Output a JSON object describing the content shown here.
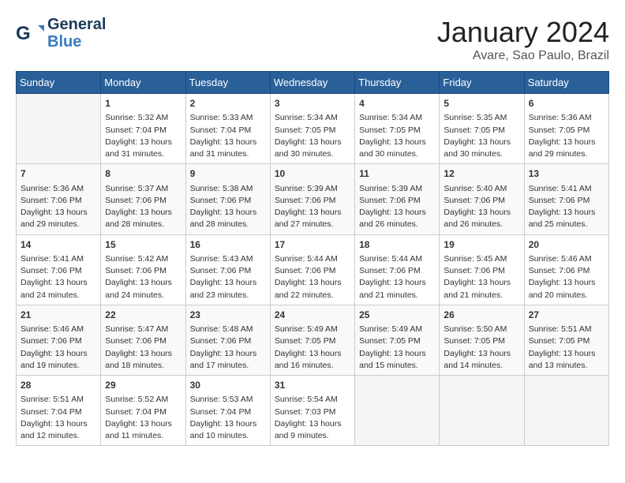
{
  "logo": {
    "line1": "General",
    "line2": "Blue"
  },
  "title": "January 2024",
  "subtitle": "Avare, Sao Paulo, Brazil",
  "headers": [
    "Sunday",
    "Monday",
    "Tuesday",
    "Wednesday",
    "Thursday",
    "Friday",
    "Saturday"
  ],
  "weeks": [
    [
      {
        "day": "",
        "content": ""
      },
      {
        "day": "1",
        "content": "Sunrise: 5:32 AM\nSunset: 7:04 PM\nDaylight: 13 hours\nand 31 minutes."
      },
      {
        "day": "2",
        "content": "Sunrise: 5:33 AM\nSunset: 7:04 PM\nDaylight: 13 hours\nand 31 minutes."
      },
      {
        "day": "3",
        "content": "Sunrise: 5:34 AM\nSunset: 7:05 PM\nDaylight: 13 hours\nand 30 minutes."
      },
      {
        "day": "4",
        "content": "Sunrise: 5:34 AM\nSunset: 7:05 PM\nDaylight: 13 hours\nand 30 minutes."
      },
      {
        "day": "5",
        "content": "Sunrise: 5:35 AM\nSunset: 7:05 PM\nDaylight: 13 hours\nand 30 minutes."
      },
      {
        "day": "6",
        "content": "Sunrise: 5:36 AM\nSunset: 7:05 PM\nDaylight: 13 hours\nand 29 minutes."
      }
    ],
    [
      {
        "day": "7",
        "content": "Sunrise: 5:36 AM\nSunset: 7:06 PM\nDaylight: 13 hours\nand 29 minutes."
      },
      {
        "day": "8",
        "content": "Sunrise: 5:37 AM\nSunset: 7:06 PM\nDaylight: 13 hours\nand 28 minutes."
      },
      {
        "day": "9",
        "content": "Sunrise: 5:38 AM\nSunset: 7:06 PM\nDaylight: 13 hours\nand 28 minutes."
      },
      {
        "day": "10",
        "content": "Sunrise: 5:39 AM\nSunset: 7:06 PM\nDaylight: 13 hours\nand 27 minutes."
      },
      {
        "day": "11",
        "content": "Sunrise: 5:39 AM\nSunset: 7:06 PM\nDaylight: 13 hours\nand 26 minutes."
      },
      {
        "day": "12",
        "content": "Sunrise: 5:40 AM\nSunset: 7:06 PM\nDaylight: 13 hours\nand 26 minutes."
      },
      {
        "day": "13",
        "content": "Sunrise: 5:41 AM\nSunset: 7:06 PM\nDaylight: 13 hours\nand 25 minutes."
      }
    ],
    [
      {
        "day": "14",
        "content": "Sunrise: 5:41 AM\nSunset: 7:06 PM\nDaylight: 13 hours\nand 24 minutes."
      },
      {
        "day": "15",
        "content": "Sunrise: 5:42 AM\nSunset: 7:06 PM\nDaylight: 13 hours\nand 24 minutes."
      },
      {
        "day": "16",
        "content": "Sunrise: 5:43 AM\nSunset: 7:06 PM\nDaylight: 13 hours\nand 23 minutes."
      },
      {
        "day": "17",
        "content": "Sunrise: 5:44 AM\nSunset: 7:06 PM\nDaylight: 13 hours\nand 22 minutes."
      },
      {
        "day": "18",
        "content": "Sunrise: 5:44 AM\nSunset: 7:06 PM\nDaylight: 13 hours\nand 21 minutes."
      },
      {
        "day": "19",
        "content": "Sunrise: 5:45 AM\nSunset: 7:06 PM\nDaylight: 13 hours\nand 21 minutes."
      },
      {
        "day": "20",
        "content": "Sunrise: 5:46 AM\nSunset: 7:06 PM\nDaylight: 13 hours\nand 20 minutes."
      }
    ],
    [
      {
        "day": "21",
        "content": "Sunrise: 5:46 AM\nSunset: 7:06 PM\nDaylight: 13 hours\nand 19 minutes."
      },
      {
        "day": "22",
        "content": "Sunrise: 5:47 AM\nSunset: 7:06 PM\nDaylight: 13 hours\nand 18 minutes."
      },
      {
        "day": "23",
        "content": "Sunrise: 5:48 AM\nSunset: 7:06 PM\nDaylight: 13 hours\nand 17 minutes."
      },
      {
        "day": "24",
        "content": "Sunrise: 5:49 AM\nSunset: 7:05 PM\nDaylight: 13 hours\nand 16 minutes."
      },
      {
        "day": "25",
        "content": "Sunrise: 5:49 AM\nSunset: 7:05 PM\nDaylight: 13 hours\nand 15 minutes."
      },
      {
        "day": "26",
        "content": "Sunrise: 5:50 AM\nSunset: 7:05 PM\nDaylight: 13 hours\nand 14 minutes."
      },
      {
        "day": "27",
        "content": "Sunrise: 5:51 AM\nSunset: 7:05 PM\nDaylight: 13 hours\nand 13 minutes."
      }
    ],
    [
      {
        "day": "28",
        "content": "Sunrise: 5:51 AM\nSunset: 7:04 PM\nDaylight: 13 hours\nand 12 minutes."
      },
      {
        "day": "29",
        "content": "Sunrise: 5:52 AM\nSunset: 7:04 PM\nDaylight: 13 hours\nand 11 minutes."
      },
      {
        "day": "30",
        "content": "Sunrise: 5:53 AM\nSunset: 7:04 PM\nDaylight: 13 hours\nand 10 minutes."
      },
      {
        "day": "31",
        "content": "Sunrise: 5:54 AM\nSunset: 7:03 PM\nDaylight: 13 hours\nand 9 minutes."
      },
      {
        "day": "",
        "content": ""
      },
      {
        "day": "",
        "content": ""
      },
      {
        "day": "",
        "content": ""
      }
    ]
  ]
}
